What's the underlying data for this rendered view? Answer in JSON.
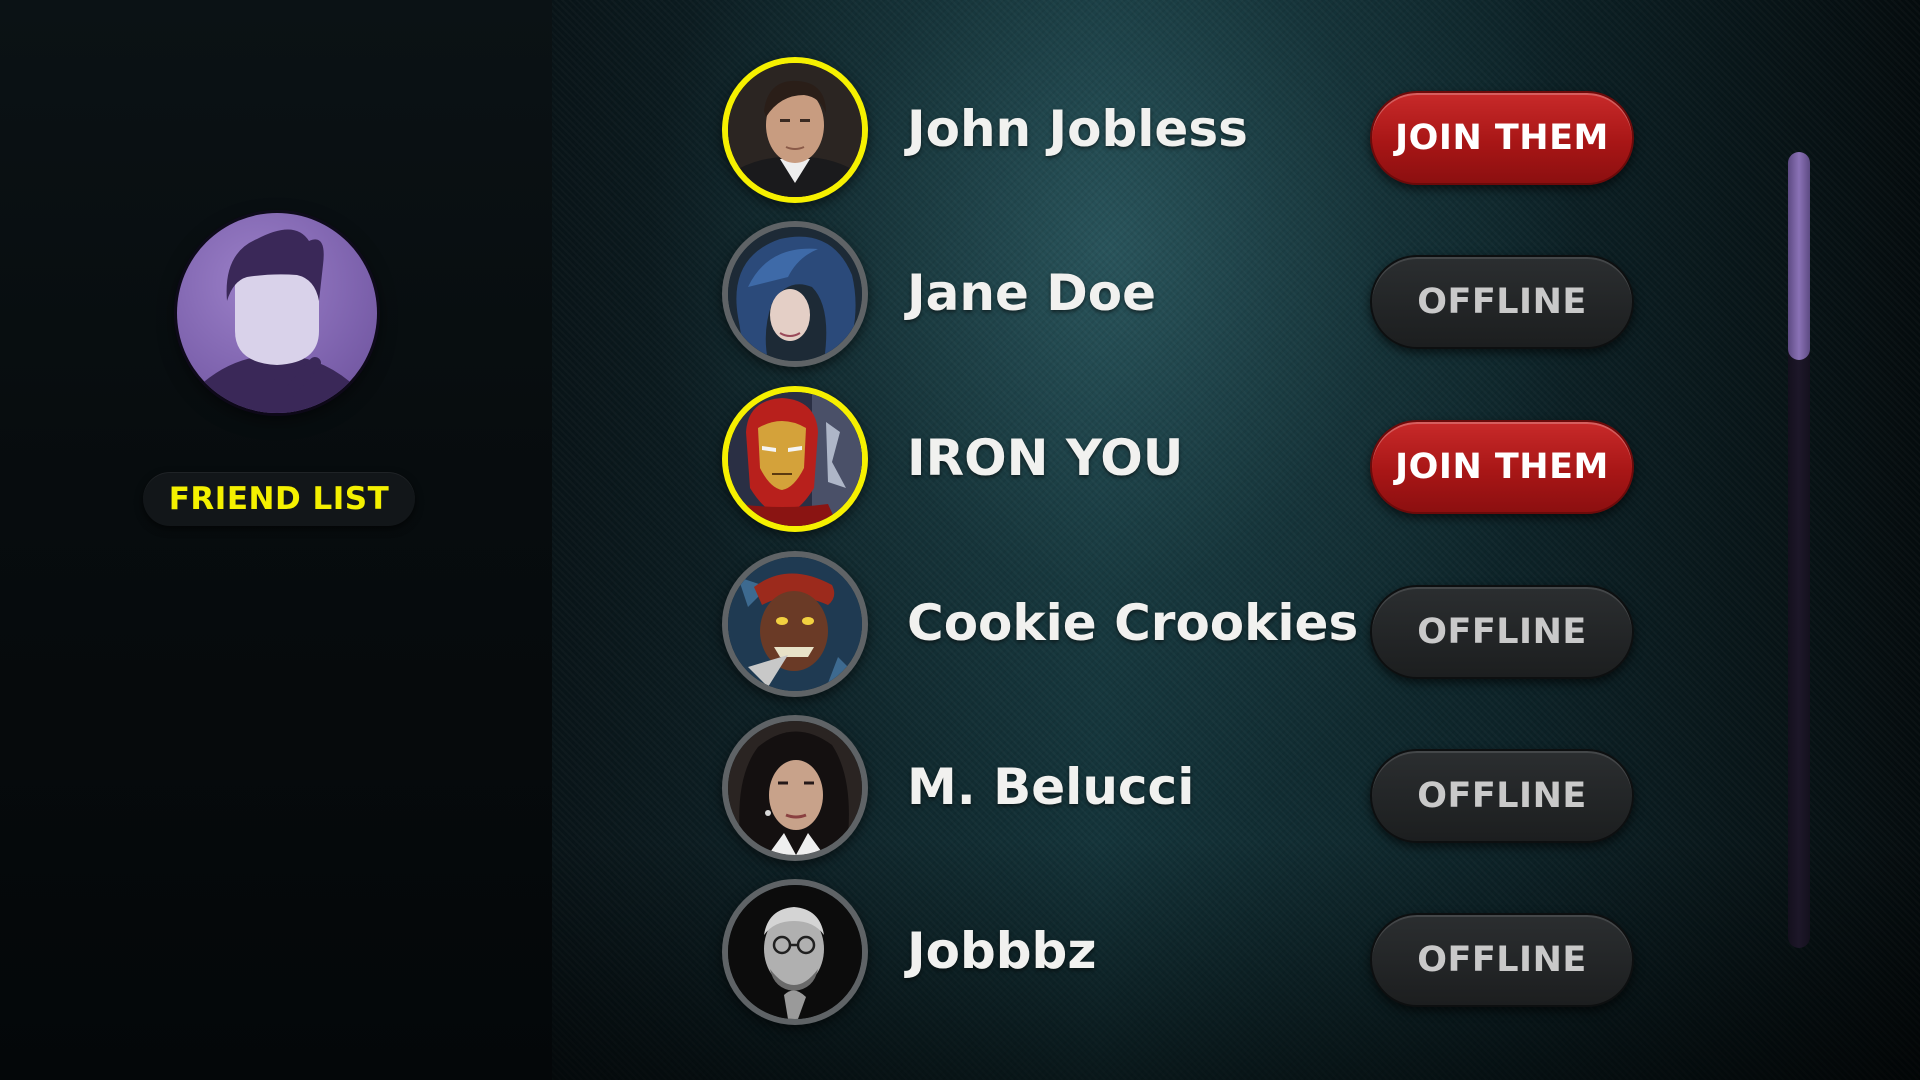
{
  "sidebar": {
    "profile_icon": "user-check-icon",
    "title": "FRIEND LIST"
  },
  "friends": [
    {
      "name": "John Jobless",
      "status": "online",
      "action_label": "JOIN THEM"
    },
    {
      "name": "Jane Doe",
      "status": "offline",
      "action_label": "OFFLINE"
    },
    {
      "name": "IRON YOU",
      "status": "online",
      "action_label": "JOIN THEM"
    },
    {
      "name": "Cookie Crookies",
      "status": "offline",
      "action_label": "OFFLINE"
    },
    {
      "name": "M. Belucci",
      "status": "offline",
      "action_label": "OFFLINE"
    },
    {
      "name": "Jobbbz",
      "status": "offline",
      "action_label": "OFFLINE"
    }
  ],
  "colors": {
    "online_ring": "#f6f000",
    "offline_ring": "#5f6366",
    "join_button": "#a81616",
    "offline_button": "#1f2122",
    "accent_purple": "#7d62ad",
    "title_yellow": "#f4f000"
  }
}
